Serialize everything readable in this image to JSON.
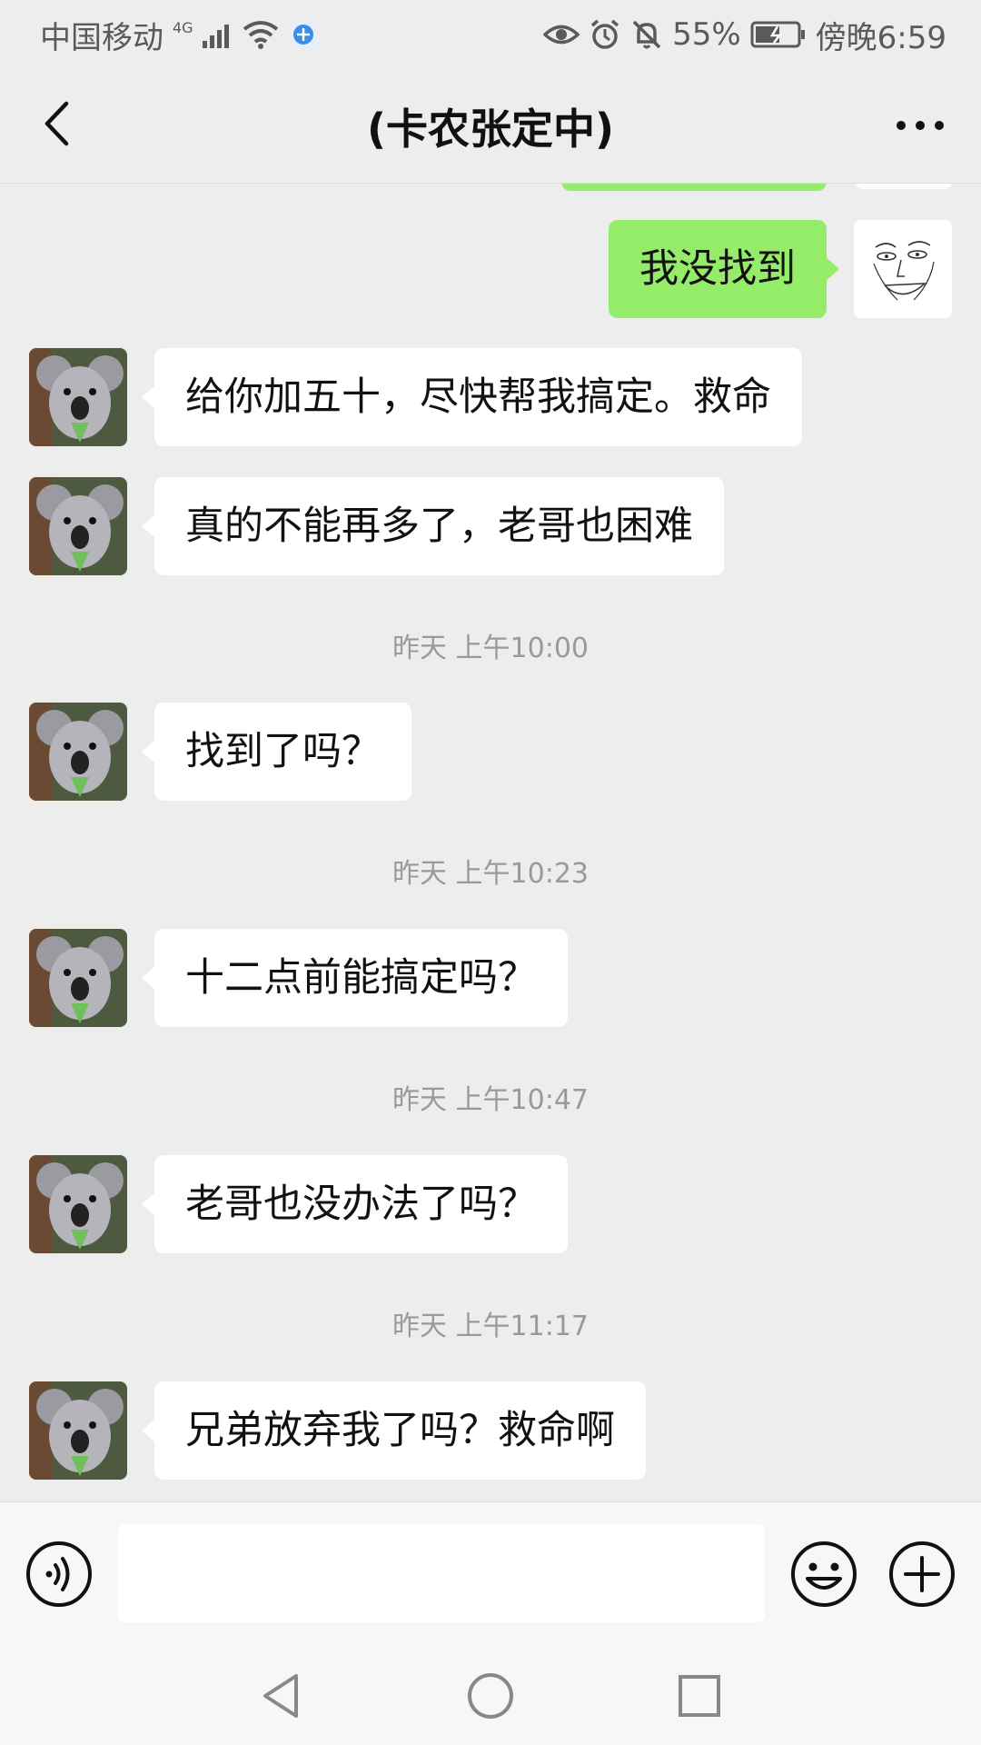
{
  "status_bar": {
    "carrier": "中国移动",
    "network": "4G",
    "battery": "55%",
    "time": "傍晚6:59"
  },
  "header": {
    "title": "(卡农张定中)"
  },
  "messages": [
    {
      "type": "out",
      "text": "我没找到",
      "avatar": "sketch-face-avatar"
    },
    {
      "type": "in",
      "text": "给你加五十，尽快帮我搞定。救命",
      "avatar": "koala-avatar"
    },
    {
      "type": "in",
      "text": "真的不能再多了，老哥也困难",
      "avatar": "koala-avatar"
    },
    {
      "type": "time",
      "text": "昨天 上午10:00"
    },
    {
      "type": "in",
      "text": "找到了吗？",
      "avatar": "koala-avatar"
    },
    {
      "type": "time",
      "text": "昨天 上午10:23"
    },
    {
      "type": "in",
      "text": "十二点前能搞定吗？",
      "avatar": "koala-avatar"
    },
    {
      "type": "time",
      "text": "昨天 上午10:47"
    },
    {
      "type": "in",
      "text": "老哥也没办法了吗？",
      "avatar": "koala-avatar"
    },
    {
      "type": "time",
      "text": "昨天 上午11:17"
    },
    {
      "type": "in",
      "text": "兄弟放弃我了吗？救命啊",
      "avatar": "koala-avatar"
    }
  ],
  "input": {
    "value": "",
    "placeholder": ""
  },
  "icons": {
    "back": "chevron-left-icon",
    "more": "more-dots-icon",
    "voice": "voice-icon",
    "emoji": "emoji-icon",
    "plus": "plus-icon"
  },
  "colors": {
    "background": "#ededed",
    "outgoing_bubble": "#95ec69",
    "incoming_bubble": "#ffffff",
    "timestamp_text": "#9a9a9a"
  }
}
